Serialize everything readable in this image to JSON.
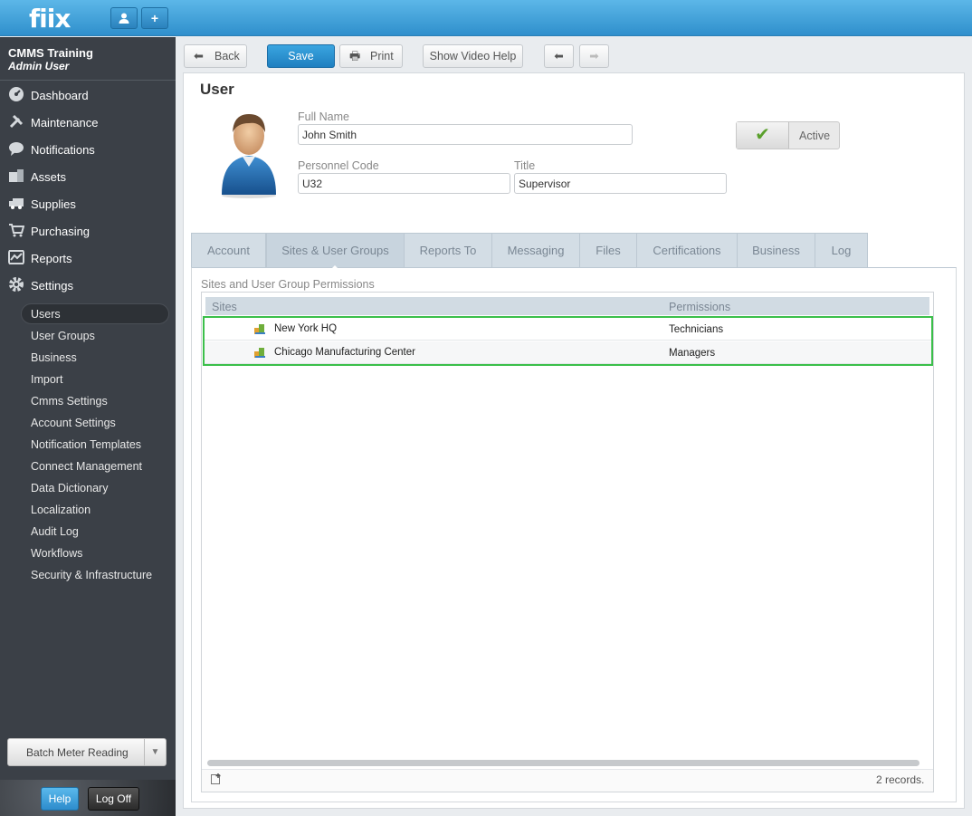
{
  "app": {
    "logo": "fiix",
    "user_icon": "user-icon",
    "add_icon": "+"
  },
  "sidebar": {
    "company": "CMMS Training",
    "role": "Admin User",
    "nav": [
      {
        "label": "Dashboard",
        "icon": "dashboard-icon"
      },
      {
        "label": "Maintenance",
        "icon": "tools-icon"
      },
      {
        "label": "Notifications",
        "icon": "chat-bubble-icon"
      },
      {
        "label": "Assets",
        "icon": "boxes-icon"
      },
      {
        "label": "Supplies",
        "icon": "truck-icon"
      },
      {
        "label": "Purchasing",
        "icon": "cart-icon"
      },
      {
        "label": "Reports",
        "icon": "chart-icon"
      },
      {
        "label": "Settings",
        "icon": "gear-icon"
      }
    ],
    "settings_items": [
      "Users",
      "User Groups",
      "Business",
      "Import",
      "Cmms Settings",
      "Account Settings",
      "Notification Templates",
      "Connect Management",
      "Data Dictionary",
      "Localization",
      "Audit Log",
      "Workflows",
      "Security & Infrastructure"
    ],
    "batch_label": "Batch Meter Reading",
    "help_label": "Help",
    "logoff_label": "Log Off"
  },
  "toolbar": {
    "back_label": "Back",
    "save_label": "Save",
    "print_label": "Print",
    "video_label": "Show Video Help"
  },
  "form": {
    "title": "User",
    "full_name_label": "Full Name",
    "full_name_value": "John Smith",
    "personnel_code_label": "Personnel Code",
    "personnel_code_value": "U32",
    "title_label": "Title",
    "title_value": "Supervisor",
    "active_label": "Active",
    "active_check": "✔"
  },
  "tabs": [
    "Account",
    "Sites & User Groups",
    "Reports To",
    "Messaging",
    "Files",
    "Certifications",
    "Business",
    "Log"
  ],
  "active_tab": "Sites & User Groups",
  "permissions": {
    "section_title": "Sites and User Group Permissions",
    "col_sites": "Sites",
    "col_permissions": "Permissions",
    "rows": [
      {
        "site": "New York HQ",
        "permission": "Technicians"
      },
      {
        "site": "Chicago Manufacturing Center",
        "permission": "Managers"
      }
    ],
    "records": "2 records."
  },
  "colors": {
    "accent": "#2f8fcc",
    "sidebar": "#3b4047",
    "highlight": "#3bbf4a"
  }
}
